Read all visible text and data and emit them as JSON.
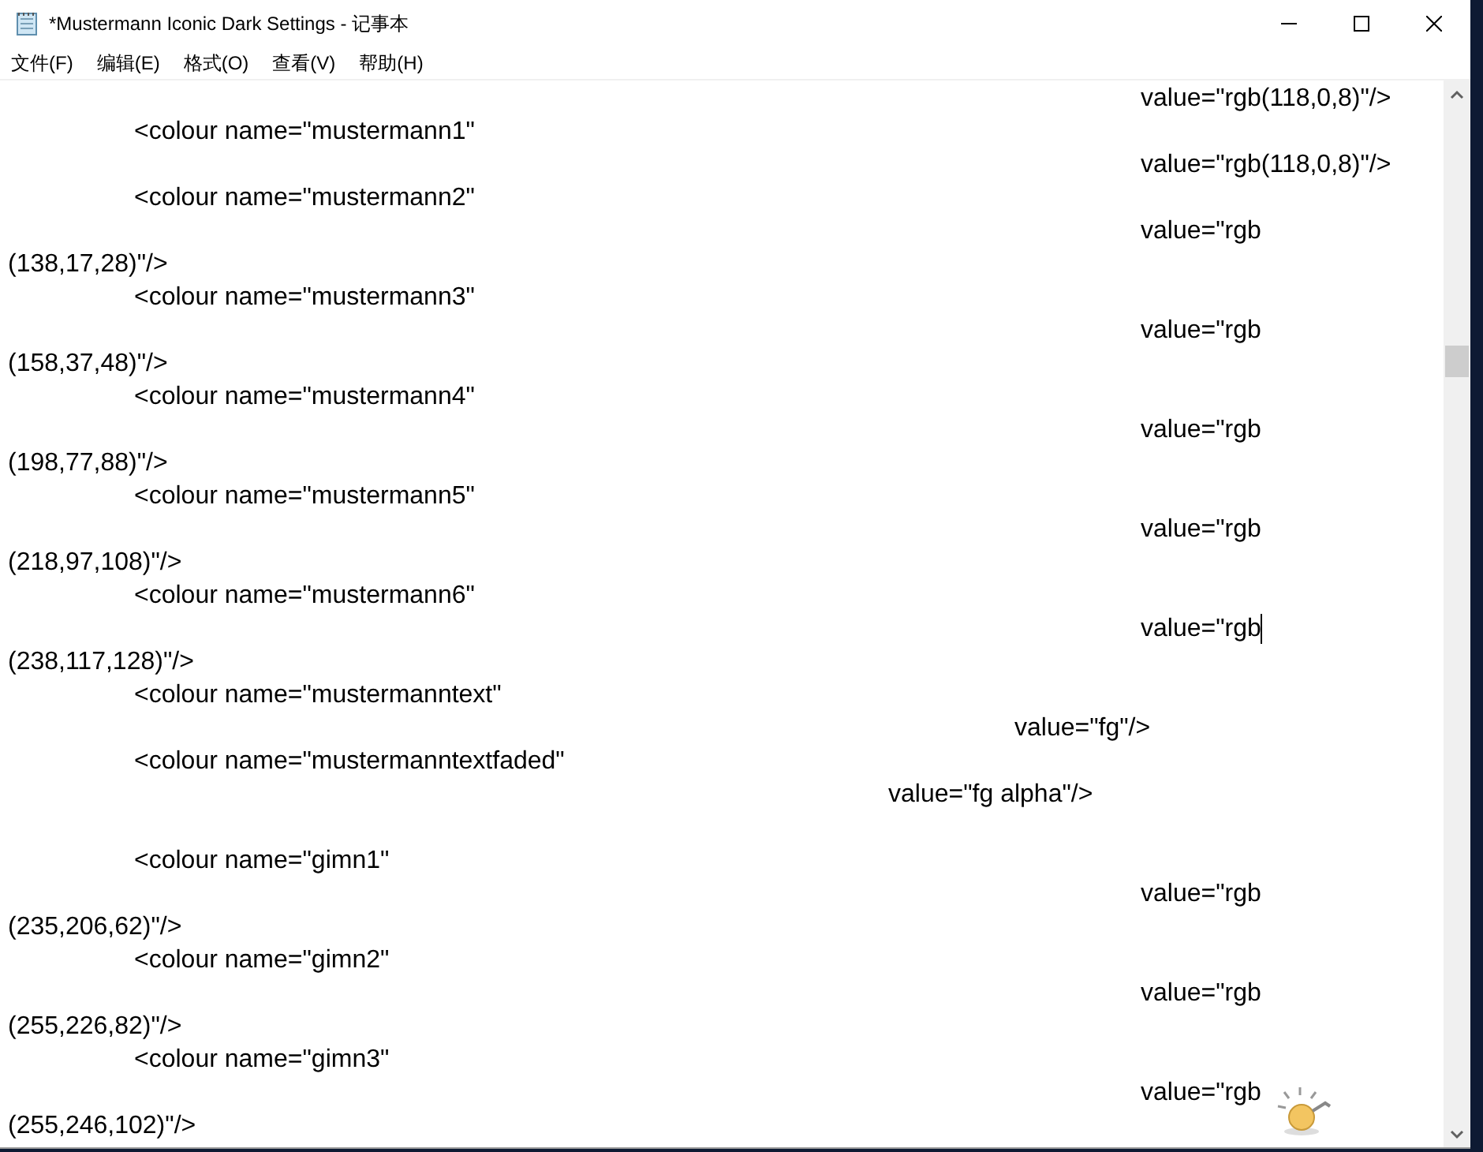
{
  "window": {
    "title": "*Mustermann Iconic Dark Settings - 记事本"
  },
  "menu": [
    {
      "label": "文件(F)"
    },
    {
      "label": "编辑(E)"
    },
    {
      "label": "格式(O)"
    },
    {
      "label": "查看(V)"
    },
    {
      "label": "帮助(H)"
    }
  ],
  "lines": [
    {
      "kind": "value-far",
      "text": "value=\"rgb(118,0,8)\"/>",
      "cursor": false
    },
    {
      "kind": "tag",
      "text": "<colour name=\"mustermann1\"",
      "cursor": false
    },
    {
      "kind": "value-far",
      "text": "value=\"rgb(118,0,8)\"/>",
      "cursor": false
    },
    {
      "kind": "tag",
      "text": "<colour name=\"mustermann2\"",
      "cursor": false
    },
    {
      "kind": "value-far",
      "text": "value=\"rgb",
      "cursor": false
    },
    {
      "kind": "continuation",
      "text": "(138,17,28)\"/>",
      "cursor": false
    },
    {
      "kind": "tag",
      "text": "<colour name=\"mustermann3\"",
      "cursor": false
    },
    {
      "kind": "value-far",
      "text": "value=\"rgb",
      "cursor": false
    },
    {
      "kind": "continuation",
      "text": "(158,37,48)\"/>",
      "cursor": false
    },
    {
      "kind": "tag",
      "text": "<colour name=\"mustermann4\"",
      "cursor": false
    },
    {
      "kind": "value-far",
      "text": "value=\"rgb",
      "cursor": false
    },
    {
      "kind": "continuation",
      "text": "(198,77,88)\"/>",
      "cursor": false
    },
    {
      "kind": "tag",
      "text": "<colour name=\"mustermann5\"",
      "cursor": false
    },
    {
      "kind": "value-far",
      "text": "value=\"rgb",
      "cursor": false
    },
    {
      "kind": "continuation",
      "text": "(218,97,108)\"/>",
      "cursor": false
    },
    {
      "kind": "tag",
      "text": "<colour name=\"mustermann6\"",
      "cursor": false
    },
    {
      "kind": "value-far",
      "text": "value=\"rgb",
      "cursor": true
    },
    {
      "kind": "continuation",
      "text": "(238,117,128)\"/>",
      "cursor": false
    },
    {
      "kind": "tag",
      "text": "<colour name=\"mustermanntext\"",
      "cursor": false
    },
    {
      "kind": "value-mid",
      "text": "value=\"fg\"/>",
      "cursor": false
    },
    {
      "kind": "tag",
      "text": "<colour name=\"mustermanntextfaded\"",
      "cursor": false
    },
    {
      "kind": "value-near",
      "text": "value=\"fg alpha\"/>",
      "cursor": false
    },
    {
      "kind": "blank",
      "cursor": false
    },
    {
      "kind": "tag",
      "text": "<colour name=\"gimn1\"",
      "cursor": false
    },
    {
      "kind": "value-far",
      "text": "value=\"rgb",
      "cursor": false
    },
    {
      "kind": "continuation",
      "text": "(235,206,62)\"/>",
      "cursor": false
    },
    {
      "kind": "tag",
      "text": "<colour name=\"gimn2\"",
      "cursor": false
    },
    {
      "kind": "value-far",
      "text": "value=\"rgb",
      "cursor": false
    },
    {
      "kind": "continuation",
      "text": "(255,226,82)\"/>",
      "cursor": false
    },
    {
      "kind": "tag",
      "text": "<colour name=\"gimn3\"",
      "cursor": false
    },
    {
      "kind": "value-far",
      "text": "value=\"rgb",
      "cursor": false
    },
    {
      "kind": "continuation",
      "text": "(255,246,102)\"/>",
      "cursor": false
    }
  ]
}
